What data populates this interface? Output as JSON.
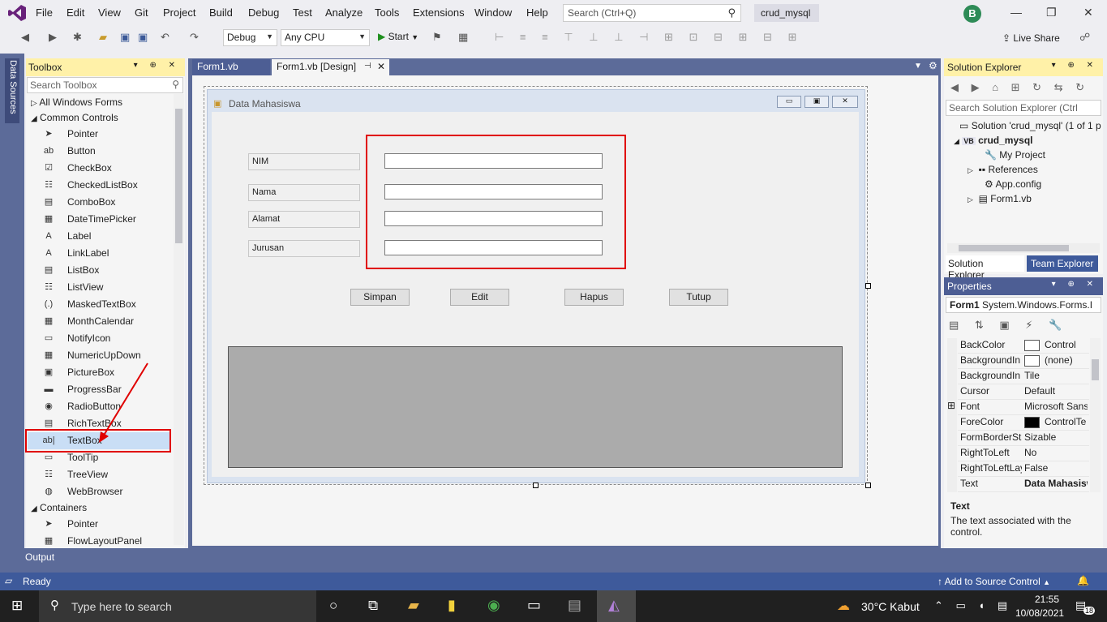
{
  "menu": [
    "File",
    "Edit",
    "View",
    "Git",
    "Project",
    "Build",
    "Debug",
    "Test",
    "Analyze",
    "Tools",
    "Extensions",
    "Window",
    "Help"
  ],
  "search_placeholder": "Search (Ctrl+Q)",
  "solution_name": "crud_mysql",
  "user_initial": "B",
  "toolbar": {
    "config": "Debug",
    "platform": "Any CPU",
    "start": "Start",
    "live_share": "Live Share"
  },
  "left_tab": "Data Sources",
  "toolbox": {
    "title": "Toolbox",
    "search_placeholder": "Search Toolbox",
    "categories": {
      "all": "All Windows Forms",
      "common": "Common Controls",
      "containers": "Containers"
    },
    "items": [
      "Pointer",
      "Button",
      "CheckBox",
      "CheckedListBox",
      "ComboBox",
      "DateTimePicker",
      "Label",
      "LinkLabel",
      "ListBox",
      "ListView",
      "MaskedTextBox",
      "MonthCalendar",
      "NotifyIcon",
      "NumericUpDown",
      "PictureBox",
      "ProgressBar",
      "RadioButton",
      "RichTextBox",
      "TextBox",
      "ToolTip",
      "TreeView",
      "WebBrowser"
    ],
    "container_items": [
      "Pointer",
      "FlowLayoutPanel"
    ]
  },
  "tabs": {
    "code": "Form1.vb",
    "design": "Form1.vb [Design]"
  },
  "form": {
    "title": "Data Mahasiswa",
    "labels": [
      "NIM",
      "Nama",
      "Alamat",
      "Jurusan"
    ],
    "buttons": [
      "Simpan",
      "Edit",
      "Hapus",
      "Tutup"
    ]
  },
  "solution_explorer": {
    "title": "Solution Explorer",
    "search_placeholder": "Search Solution Explorer (Ctrl",
    "solution": "Solution 'crud_mysql' (1 of 1 p",
    "project": "crud_mysql",
    "nodes": [
      "My Project",
      "References",
      "App.config",
      "Form1.vb"
    ],
    "tab_se": "Solution Explorer",
    "tab_te": "Team Explorer"
  },
  "properties": {
    "title": "Properties",
    "object": "Form1",
    "object_type": "System.Windows.Forms.I",
    "rows": [
      {
        "name": "BackColor",
        "value": "Control"
      },
      {
        "name": "BackgroundIn",
        "value": "(none)"
      },
      {
        "name": "BackgroundIn",
        "value": "Tile"
      },
      {
        "name": "Cursor",
        "value": "Default"
      },
      {
        "name": "Font",
        "value": "Microsoft Sans"
      },
      {
        "name": "ForeColor",
        "value": "ControlTe"
      },
      {
        "name": "FormBorderSt",
        "value": "Sizable"
      },
      {
        "name": "RightToLeft",
        "value": "No"
      },
      {
        "name": "RightToLeftLay",
        "value": "False"
      },
      {
        "name": "Text",
        "value": "Data Mahasisw"
      }
    ],
    "desc_title": "Text",
    "desc": "The text associated with the control."
  },
  "output_tab": "Output",
  "status": {
    "ready": "Ready",
    "source_control": "Add to Source Control"
  },
  "taskbar": {
    "search": "Type here to search",
    "weather": "30°C  Kabut",
    "time": "21:55",
    "date": "10/08/2021",
    "notifications": "18"
  },
  "colors": {
    "accent": "#68217a",
    "highlight_red": "#e00000",
    "status_bar": "#3e5a9b"
  }
}
